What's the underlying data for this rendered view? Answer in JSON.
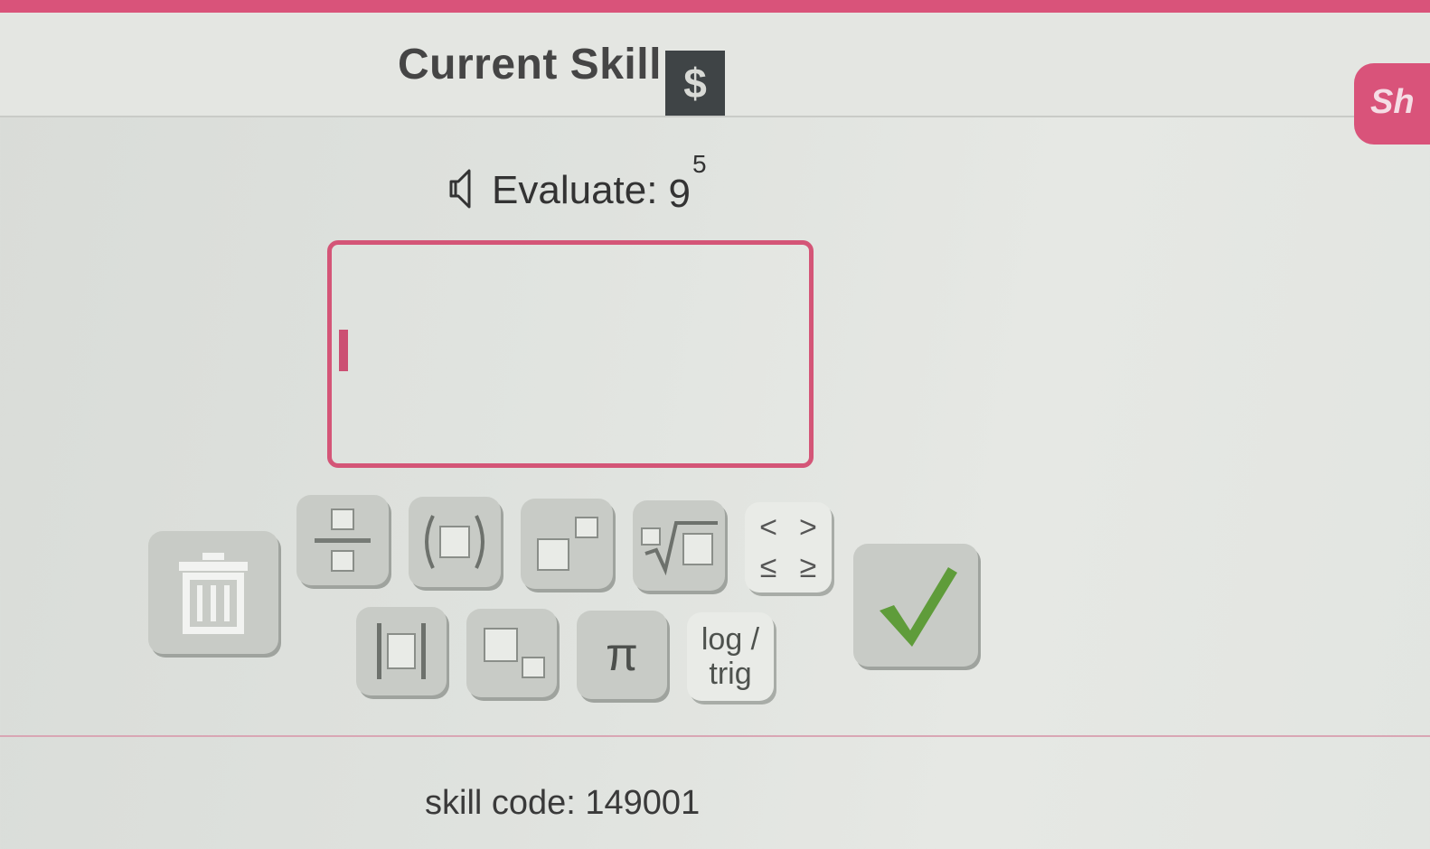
{
  "header": {
    "title": "Current Skill",
    "badge_symbol": "$",
    "show_button_label": "Sh"
  },
  "question": {
    "label": "Evaluate:",
    "base": "9",
    "exponent": "5"
  },
  "keypad": {
    "row1": [
      {
        "name": "fraction-key",
        "icon": "fraction-icon"
      },
      {
        "name": "parentheses-key",
        "icon": "parentheses-icon"
      },
      {
        "name": "exponent-key",
        "icon": "exponent-icon"
      },
      {
        "name": "nth-root-key",
        "icon": "nth-root-icon"
      },
      {
        "name": "inequality-key",
        "symbols": [
          "<",
          ">",
          "≤",
          "≥"
        ]
      }
    ],
    "row2": [
      {
        "name": "absolute-value-key",
        "icon": "absolute-value-icon"
      },
      {
        "name": "subscript-key",
        "icon": "subscript-icon"
      },
      {
        "name": "pi-key",
        "label": "π"
      },
      {
        "name": "log-trig-key",
        "label": "log /\ntrig"
      }
    ],
    "delete_icon": "trash-icon",
    "submit_icon": "checkmark-icon"
  },
  "footer": {
    "skill_code": "skill code: 149001"
  },
  "colors": {
    "accent": "#d9537a",
    "submit_check": "#5f9c3a",
    "badge_bg": "#3f4446"
  }
}
